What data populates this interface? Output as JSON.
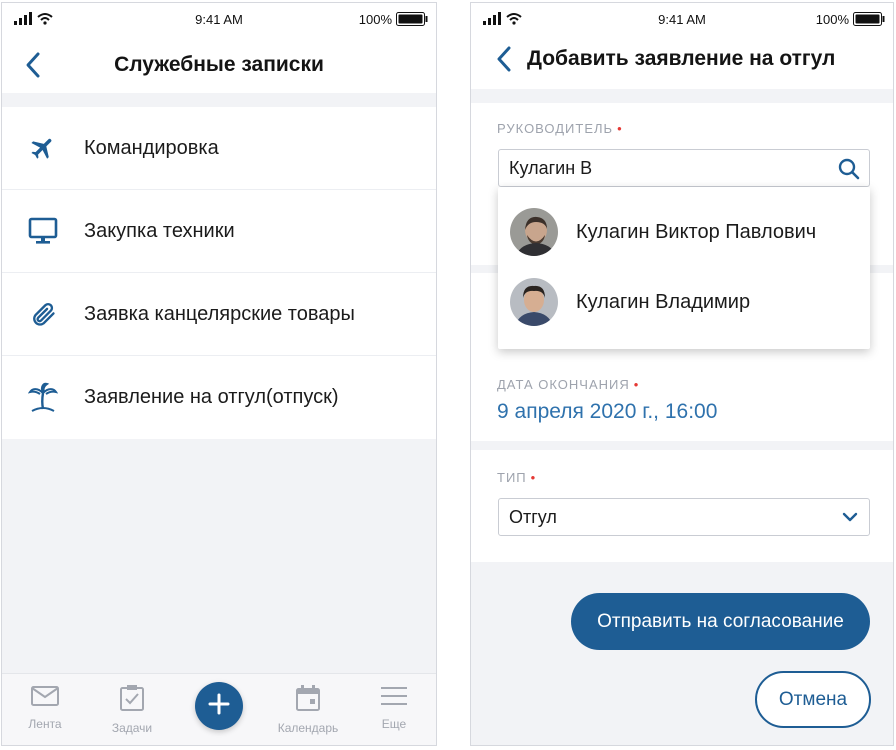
{
  "screen1": {
    "status": {
      "time": "9:41 AM",
      "battery": "100%"
    },
    "title": "Служебные записки",
    "menu": [
      {
        "icon": "airplane-icon",
        "label": "Командировка"
      },
      {
        "icon": "monitor-icon",
        "label": "Закупка техники"
      },
      {
        "icon": "paperclip-icon",
        "label": "Заявка канцелярские товары"
      },
      {
        "icon": "palm-tree-icon",
        "label": "Заявление на отгул(отпуск)"
      }
    ],
    "tabbar": [
      {
        "icon": "mail-icon",
        "label": "Лента"
      },
      {
        "icon": "clipboard-check-icon",
        "label": "Задачи"
      },
      {
        "icon": "plus-icon",
        "label": ""
      },
      {
        "icon": "calendar-icon",
        "label": "Календарь"
      },
      {
        "icon": "menu-icon",
        "label": "Еще"
      }
    ]
  },
  "screen2": {
    "status": {
      "time": "9:41 AM",
      "battery": "100%"
    },
    "title": "Добавить заявление на отгул",
    "manager": {
      "label": "РУКОВОДИТЕЛЬ",
      "required": "•",
      "value": "Кулагин В"
    },
    "suggestions": [
      {
        "name": "Кулагин Виктор Павлович",
        "avatar": "avatar-1"
      },
      {
        "name": "Кулагин Владимир",
        "avatar": "avatar-2"
      }
    ],
    "end_date": {
      "label": "ДАТА ОКОНЧАНИЯ",
      "required": "•",
      "value": "9 апреля 2020 г., 16:00"
    },
    "type": {
      "label": "ТИП",
      "required": "•",
      "value": "Отгул"
    },
    "submit_label": "Отправить на согласование",
    "cancel_label": "Отмена"
  },
  "colors": {
    "accent": "#1e5d94",
    "link": "#2f72ad",
    "required": "#e53935",
    "muted": "#9ea3ad"
  }
}
